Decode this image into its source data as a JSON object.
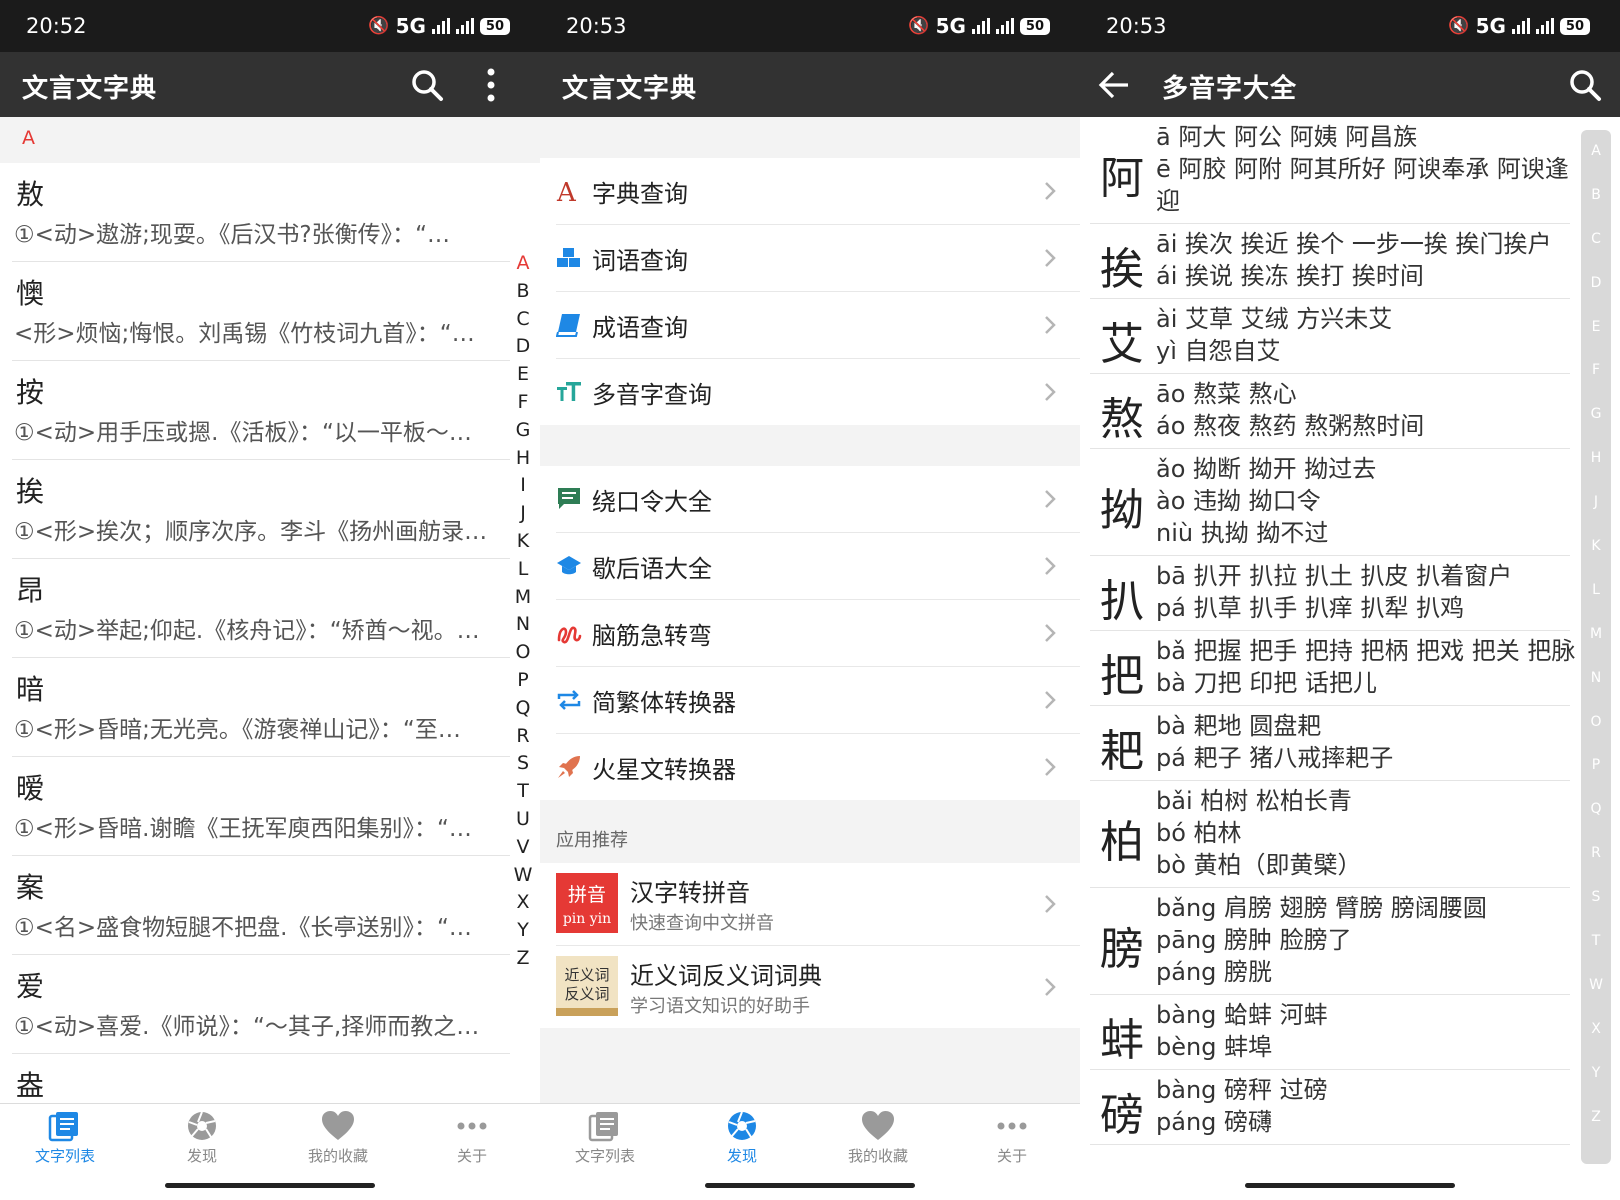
{
  "status_bar": [
    {
      "time": "20:52",
      "network": "5G",
      "battery": "50"
    },
    {
      "time": "20:53",
      "network": "5G",
      "battery": "50"
    },
    {
      "time": "20:53",
      "network": "5G",
      "battery": "50"
    }
  ],
  "panel1": {
    "title": "文言文字典",
    "section_letter": "A",
    "items": [
      {
        "char": "敖",
        "def": "①<动>遨游;现耍。《后汉书?张衡传》：“…"
      },
      {
        "char": "懊",
        "def": "<形>烦恼;悔恨。刘禹锡《竹枝词九首》：“…"
      },
      {
        "char": "按",
        "def": "①<动>用手压或摁.《活板》：“以一平板～…"
      },
      {
        "char": "挨",
        "def": "①<形>挨次；顺序次序。李斗《扬州画舫录…"
      },
      {
        "char": "昂",
        "def": "①<动>举起;仰起.《核舟记》：“矫酋～视。…"
      },
      {
        "char": "暗",
        "def": "①<形>昏暗;无光亮。《游褒禅山记》：“至…"
      },
      {
        "char": "暧",
        "def": "①<形>昏暗.谢瞻《王抚军庾西阳集别》：“…"
      },
      {
        "char": "案",
        "def": "①<名>盛食物短腿不把盘.《长亭送别》：“…"
      },
      {
        "char": "爱",
        "def": "①<动>喜爱.《师说》：“～其子,择师而教之…"
      },
      {
        "char": "盎",
        "def": ""
      }
    ],
    "alphabet": [
      "A",
      "B",
      "C",
      "D",
      "E",
      "F",
      "G",
      "H",
      "I",
      "J",
      "K",
      "L",
      "M",
      "N",
      "O",
      "P",
      "Q",
      "R",
      "S",
      "T",
      "U",
      "V",
      "W",
      "X",
      "Y",
      "Z"
    ]
  },
  "panel2": {
    "title": "文言文字典",
    "group1": [
      {
        "label": "字典查询",
        "icon": "letter-a-icon"
      },
      {
        "label": "词语查询",
        "icon": "cubes-icon"
      },
      {
        "label": "成语查询",
        "icon": "book-icon"
      },
      {
        "label": "多音字查询",
        "icon": "text-size-icon"
      }
    ],
    "group2": [
      {
        "label": "绕口令大全",
        "icon": "message-icon"
      },
      {
        "label": "歇后语大全",
        "icon": "graduation-cap-icon"
      },
      {
        "label": "脑筋急转弯",
        "icon": "squiggle-icon"
      },
      {
        "label": "简繁体转换器",
        "icon": "swap-icon"
      },
      {
        "label": "火星文转换器",
        "icon": "rocket-icon"
      }
    ],
    "recommend_header": "应用推荐",
    "recommend": [
      {
        "title": "汉字转拼音",
        "subtitle": "快速查询中文拼音",
        "icon_text_top": "拼音",
        "icon_text_bottom": "pin yin"
      },
      {
        "title": "近义词反义词词典",
        "subtitle": "学习语文知识的好助手",
        "icon_text_top": "近义词",
        "icon_text_bottom": "反义词"
      }
    ]
  },
  "panel3": {
    "title": "多音字大全",
    "items": [
      {
        "char": "阿",
        "lines": [
          "ā 阿大 阿公 阿姨 阿昌族",
          "ē 阿胶 阿附 阿其所好 阿谀奉承 阿谀逢",
          "迎"
        ]
      },
      {
        "char": "挨",
        "lines": [
          "āi 挨次 挨近 挨个 一步一挨 挨门挨户",
          "ái 挨说 挨冻 挨打 挨时间"
        ]
      },
      {
        "char": "艾",
        "lines": [
          "ài 艾草 艾绒 方兴未艾",
          "yì 自怨自艾"
        ]
      },
      {
        "char": "熬",
        "lines": [
          "āo 熬菜 熬心",
          "áo 熬夜 熬药 熬粥熬时间"
        ]
      },
      {
        "char": "拗",
        "lines": [
          "ǎo 拗断 拗开 拗过去",
          "ào 违拗 拗口令",
          "niù 执拗 拗不过"
        ]
      },
      {
        "char": "扒",
        "lines": [
          "bā 扒开 扒拉 扒土 扒皮 扒着窗户",
          "pá 扒草 扒手 扒痒 扒犁 扒鸡"
        ]
      },
      {
        "char": "把",
        "lines": [
          "bǎ 把握 把手 把持 把柄 把戏 把关 把脉",
          "bà 刀把 印把 话把儿"
        ]
      },
      {
        "char": "耙",
        "lines": [
          "bà 耙地 圆盘耙",
          "pá 耙子 猪八戒摔耙子"
        ]
      },
      {
        "char": "柏",
        "lines": [
          "bǎi 柏树 松柏长青",
          "bó 柏林",
          "bò 黄柏（即黄檗）"
        ]
      },
      {
        "char": "膀",
        "lines": [
          "bǎng 肩膀 翅膀 臂膀 膀阔腰圆",
          "pāng 膀肿 脸膀了",
          "páng 膀胱"
        ]
      },
      {
        "char": "蚌",
        "lines": [
          "bàng 蛤蚌 河蚌",
          "bèng 蚌埠"
        ]
      },
      {
        "char": "磅",
        "lines": [
          "bàng 磅秤 过磅",
          "páng 磅礴"
        ]
      }
    ],
    "index": [
      "A",
      "B",
      "C",
      "D",
      "E",
      "F",
      "G",
      "H",
      "J",
      "K",
      "L",
      "M",
      "N",
      "O",
      "P",
      "Q",
      "R",
      "S",
      "T",
      "W",
      "X",
      "Y",
      "Z"
    ]
  },
  "bottom_nav": [
    {
      "label": "文字列表",
      "icon": "list-icon"
    },
    {
      "label": "发现",
      "icon": "aperture-icon"
    },
    {
      "label": "我的收藏",
      "icon": "heart-icon"
    },
    {
      "label": "关于",
      "icon": "more-dots-icon"
    }
  ],
  "colors": {
    "accent": "#1e88e5",
    "appbar": "#323232",
    "statusbar": "#1b1b1b",
    "section_letter": "#e53935",
    "inactive": "#888888"
  }
}
